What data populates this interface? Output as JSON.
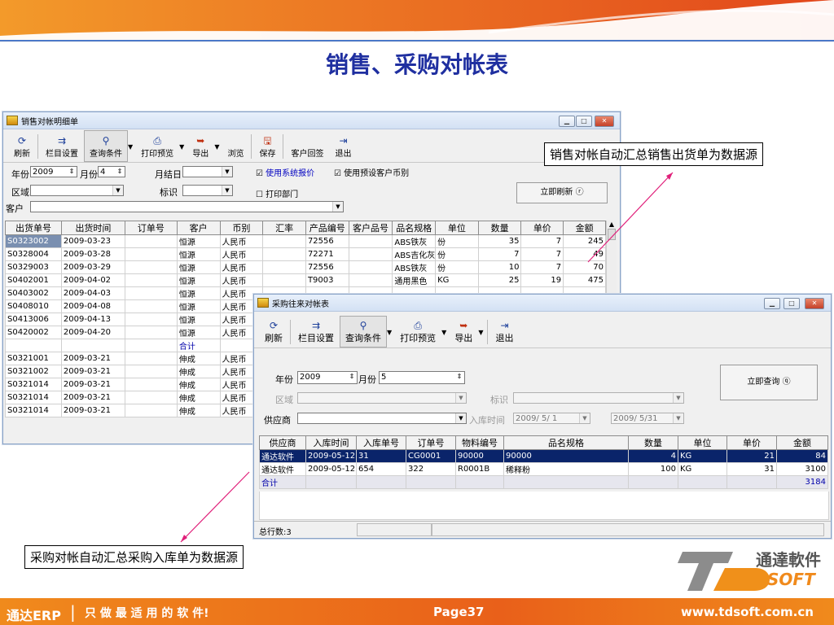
{
  "slide": {
    "title": "销售、采购对帐表",
    "callout_sales": "销售对帐自动汇总销售出货单为数据源",
    "callout_purchase": "采购对帐自动汇总采购入库单为数据源"
  },
  "footer": {
    "brand": "通达ERP",
    "slogan": "只 做 最 适 用 的 软 件!",
    "page": "Page37",
    "url": "www.tdsoft.com.cn"
  },
  "logo": {
    "cn": "通達軟件",
    "en": "SOFT",
    "mark": "TD"
  },
  "colors": {
    "accent": "#e9601a",
    "title": "#1f2fa0",
    "selection": "#0a246a"
  },
  "sales_window": {
    "title": "销售对帐明细单",
    "toolbar": [
      "刷新",
      "栏目设置",
      "查询条件",
      "打印预览",
      "导出",
      "浏览",
      "保存",
      "客户回签",
      "退出"
    ],
    "filters": {
      "year_label": "年份",
      "year_value": "2009",
      "month_label": "月份",
      "month_value": "4",
      "monthend_label": "月结日",
      "region_label": "区域",
      "tag_label": "标识",
      "customer_label": "客户",
      "chk_sys_price": "使用系统报价",
      "chk_preset_currency": "使用预设客户币别",
      "chk_print_dept": "打印部门",
      "refresh_button": "立即刷新 ⓡ"
    },
    "columns": [
      "出货单号",
      "出货时间",
      "订单号",
      "客户",
      "币别",
      "汇率",
      "产品编号",
      "客户品号",
      "品名规格",
      "单位",
      "数量",
      "单价",
      "金额"
    ],
    "rows": [
      [
        "S0323002",
        "2009-03-23",
        "",
        "恒源",
        "人民币",
        "",
        "72556",
        "",
        "ABS铁灰",
        "份",
        "35",
        "7",
        "245"
      ],
      [
        "S0328004",
        "2009-03-28",
        "",
        "恒源",
        "人民币",
        "",
        "72271",
        "",
        "ABS吉化灰",
        "份",
        "7",
        "7",
        "49"
      ],
      [
        "S0329003",
        "2009-03-29",
        "",
        "恒源",
        "人民币",
        "",
        "72556",
        "",
        "ABS铁灰",
        "份",
        "10",
        "7",
        "70"
      ],
      [
        "S0402001",
        "2009-04-02",
        "",
        "恒源",
        "人民币",
        "",
        "T9003",
        "",
        "通用黑色",
        "KG",
        "25",
        "19",
        "475"
      ],
      [
        "S0403002",
        "2009-04-03",
        "",
        "恒源",
        "人民币",
        "",
        "",
        "",
        "",
        "",
        "",
        "",
        ""
      ],
      [
        "S0408010",
        "2009-04-08",
        "",
        "恒源",
        "人民币",
        "",
        "",
        "",
        "",
        "",
        "",
        "",
        ""
      ],
      [
        "S0413006",
        "2009-04-13",
        "",
        "恒源",
        "人民币",
        "",
        "",
        "",
        "",
        "",
        "",
        "",
        ""
      ],
      [
        "S0420002",
        "2009-04-20",
        "",
        "恒源",
        "人民币",
        "",
        "",
        "",
        "",
        "",
        "",
        "",
        ""
      ],
      [
        "",
        "",
        "",
        "合计",
        "",
        "",
        "",
        "",
        "",
        "",
        "",
        "",
        ""
      ],
      [
        "S0321001",
        "2009-03-21",
        "",
        "伸成",
        "人民币",
        "",
        "",
        "",
        "",
        "",
        "",
        "",
        ""
      ],
      [
        "S0321002",
        "2009-03-21",
        "",
        "伸成",
        "人民币",
        "",
        "",
        "",
        "",
        "",
        "",
        "",
        ""
      ],
      [
        "S0321014",
        "2009-03-21",
        "",
        "伸成",
        "人民币",
        "",
        "",
        "",
        "",
        "",
        "",
        "",
        ""
      ],
      [
        "S0321014",
        "2009-03-21",
        "",
        "伸成",
        "人民币",
        "",
        "",
        "",
        "",
        "",
        "",
        "",
        ""
      ],
      [
        "S0321014",
        "2009-03-21",
        "",
        "伸成",
        "人民币",
        "",
        "",
        "",
        "",
        "",
        "",
        "",
        ""
      ]
    ]
  },
  "purchase_window": {
    "title": "采购往来对帐表",
    "toolbar": [
      "刷新",
      "栏目设置",
      "查询条件",
      "打印预览",
      "导出",
      "退出"
    ],
    "filters": {
      "year_label": "年份",
      "year_value": "2009",
      "month_label": "月份",
      "month_value": "5",
      "region_label": "区域",
      "tag_label": "标识",
      "supplier_label": "供应商",
      "intime_label": "入库时间",
      "date_from": "2009/ 5/ 1",
      "date_to": "2009/ 5/31",
      "query_button": "立即查询 ⓠ"
    },
    "columns": [
      "供应商",
      "入库时间",
      "入库单号",
      "订单号",
      "物料编号",
      "品名规格",
      "数量",
      "单位",
      "单价",
      "金额"
    ],
    "rows": [
      [
        "通达软件",
        "2009-05-12",
        "31",
        "CG0001",
        "90000",
        "90000",
        "4",
        "KG",
        "21",
        "84"
      ],
      [
        "通达软件",
        "2009-05-12",
        "654",
        "322",
        "R0001B",
        "稀释粉",
        "100",
        "KG",
        "31",
        "3100"
      ],
      [
        "合计",
        "",
        "",
        "",
        "",
        "",
        "",
        "",
        "",
        "3184"
      ]
    ],
    "status": "总行数:3"
  }
}
